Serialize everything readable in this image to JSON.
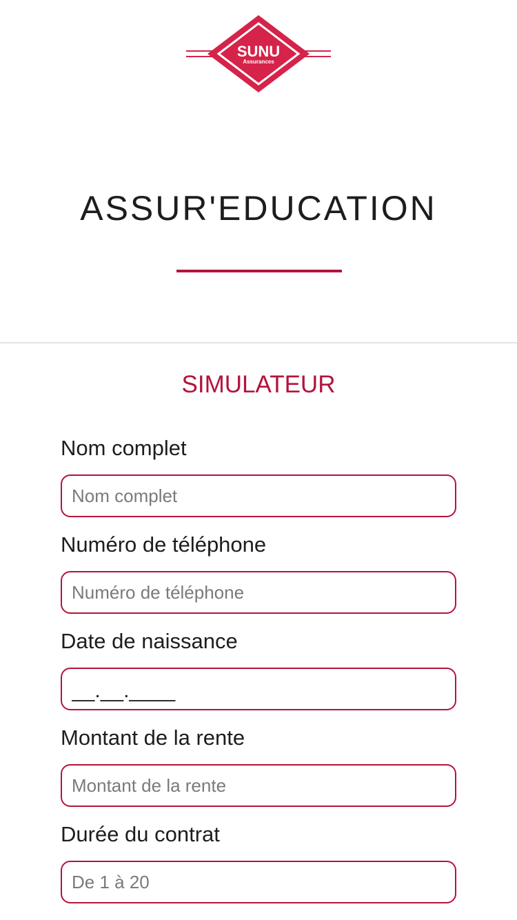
{
  "brand": {
    "logo_name": "SUNU",
    "logo_sub": "Assurances",
    "accent_color": "#b3143b",
    "logo_color": "#d5234a"
  },
  "header": {
    "title": "ASSUR'EDUCATION"
  },
  "form": {
    "section_title": "SIMULATEUR",
    "fields": [
      {
        "label": "Nom complet",
        "value": "",
        "placeholder": "Nom complet"
      },
      {
        "label": "Numéro de téléphone",
        "value": "",
        "placeholder": "Numéro de téléphone"
      },
      {
        "label": "Date de naissance",
        "value": "__.__.____",
        "placeholder": ""
      },
      {
        "label": "Montant de la rente",
        "value": "",
        "placeholder": "Montant de la rente"
      },
      {
        "label": "Durée du contrat",
        "value": "",
        "placeholder": "De 1 à 20"
      }
    ]
  }
}
